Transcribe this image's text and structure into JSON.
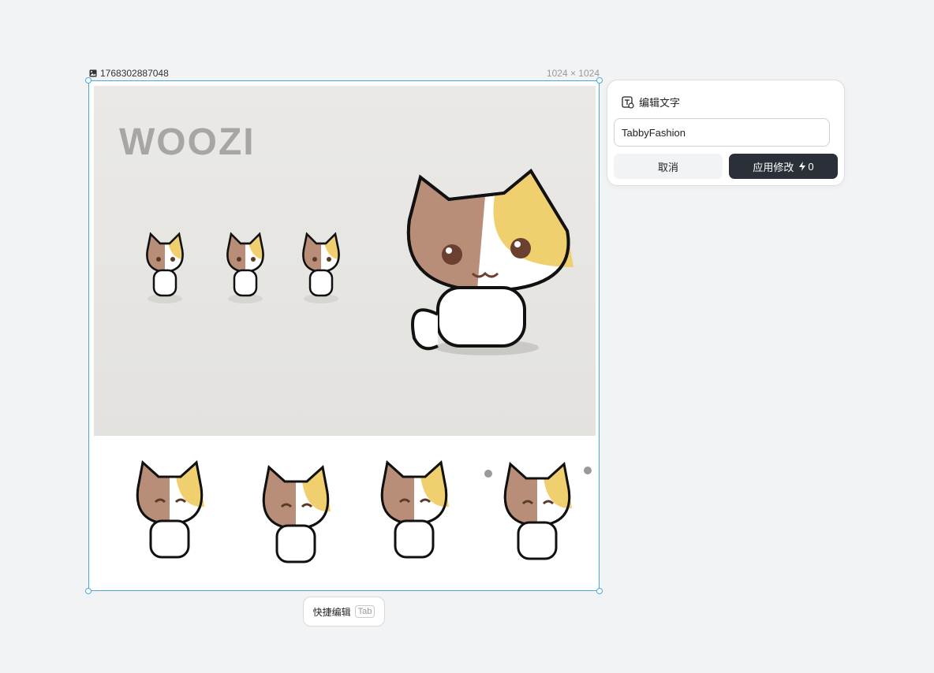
{
  "image": {
    "name": "1768302887048",
    "dimensions": "1024 × 1024",
    "artwork_brand": "WOOZI"
  },
  "editor": {
    "title": "编辑文字",
    "input_value": "TabbyFashion",
    "cancel_label": "取消",
    "apply_label": "应用修改",
    "apply_cost": "0"
  },
  "quick_edit": {
    "label": "快捷编辑",
    "shortcut": "Tab"
  },
  "colors": {
    "accent_border": "#4aa8e0",
    "primary_button": "#2b3038",
    "cat_brown": "#b88e78",
    "cat_yellow": "#f0cf6e"
  }
}
